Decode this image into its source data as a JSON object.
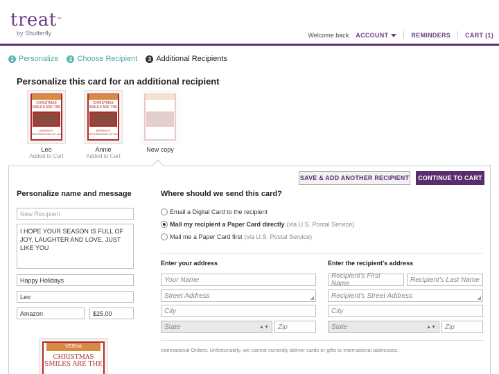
{
  "header": {
    "logo_word": "treat",
    "logo_tm": "™",
    "logo_sub": "by Shutterfly",
    "welcome": "Welcome back",
    "account": "ACCOUNT",
    "reminders": "REMINDERS",
    "cart": "CART (1)"
  },
  "steps": [
    {
      "num": "1",
      "label": "Personalize"
    },
    {
      "num": "2",
      "label": "Choose Recipient"
    },
    {
      "num": "3",
      "label": "Additional Recipients"
    }
  ],
  "page_title": "Personalize this card for an additional recipient",
  "thumbs": [
    {
      "name": "Leo",
      "status": "Added to Cart"
    },
    {
      "name": "Annie",
      "status": "Added to Cart"
    },
    {
      "name": "New copy",
      "status": ""
    }
  ],
  "card": {
    "banner": "VERNA",
    "headline": "CHRISTMAS SMILES ARE THE",
    "footer": "MERRIEST DECORATIONS OF ALL"
  },
  "buttons": {
    "save_another": "SAVE & ADD ANOTHER RECIPIENT",
    "continue": "CONTINUE TO CART"
  },
  "left": {
    "title": "Personalize name and message",
    "recipient_placeholder": "New Recipient",
    "message": "I HOPE YOUR SEASON IS FULL OF JOY, LAUGHTER AND LOVE, JUST LIKE YOU",
    "greeting": "Happy Holidays",
    "signature": "Leo",
    "gift_store": "Amazon",
    "gift_amount": "$25.00"
  },
  "right": {
    "title": "Where should we send this card?",
    "options": [
      {
        "main": "Email a Digital Card to the recipient",
        "note": ""
      },
      {
        "main": "Mail my recipient a Paper Card directly",
        "note": "(via U.S. Postal Service)"
      },
      {
        "main": "Mail me a Paper Card first",
        "note": "(via U.S. Postal Service)"
      }
    ],
    "selected_option": 1,
    "your_address_title": "Enter your address",
    "recipient_address_title": "Enter the recipient's address",
    "your_name_ph": "Your Name",
    "street_ph": "Street Address",
    "city_ph": "City",
    "state_ph": "State",
    "zip_ph": "Zip",
    "r_first_ph": "Recipient's First Name",
    "r_last_ph": "Recipient's Last Name",
    "r_street_ph": "Recipient's Street Address",
    "r_city_ph": "City",
    "r_state_ph": "State",
    "r_zip_ph": "Zip",
    "intl_note": "International Orders: Unfortunately, we cannot currently deliver cards or gifts to international addresses."
  },
  "colors": {
    "brand": "#5a2e6e",
    "step_done": "#5bb5b0",
    "card_red": "#b42a2a"
  }
}
